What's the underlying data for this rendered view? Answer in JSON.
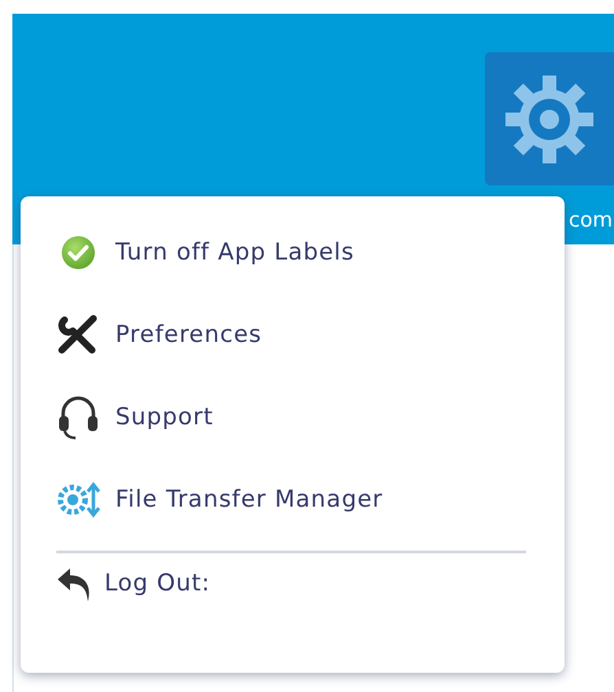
{
  "header": {
    "domain_fragment": "com"
  },
  "menu": {
    "items": [
      {
        "label": "Turn off App Labels"
      },
      {
        "label": "Preferences"
      },
      {
        "label": "Support"
      },
      {
        "label": "File Transfer Manager"
      }
    ],
    "footer_item": {
      "label": "Log Out:"
    }
  }
}
